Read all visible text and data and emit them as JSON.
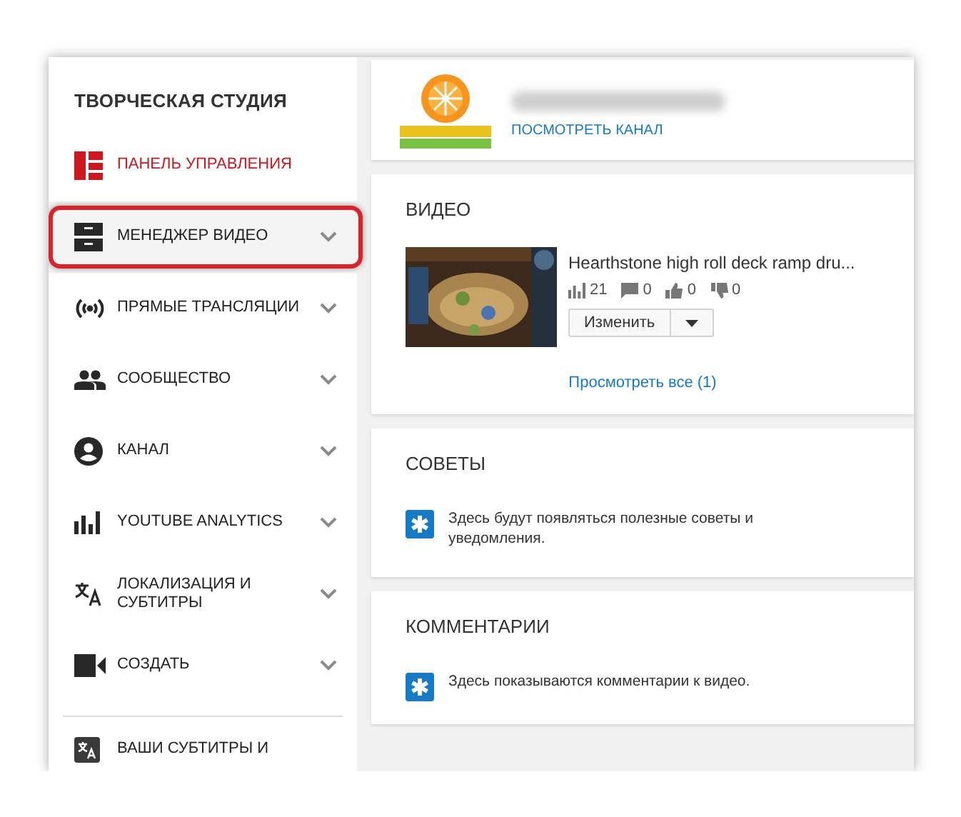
{
  "sidebar": {
    "title": "ТВОРЧЕСКАЯ СТУДИЯ",
    "items": [
      {
        "label": "ПАНЕЛЬ УПРАВЛЕНИЯ",
        "selected": true,
        "expandable": false,
        "highlighted": false
      },
      {
        "label": "МЕНЕДЖЕР ВИДЕО",
        "selected": false,
        "expandable": true,
        "highlighted": true
      },
      {
        "label": "ПРЯМЫЕ ТРАНСЛЯЦИИ",
        "selected": false,
        "expandable": true,
        "highlighted": false
      },
      {
        "label": "СООБЩЕСТВО",
        "selected": false,
        "expandable": true,
        "highlighted": false
      },
      {
        "label": "КАНАЛ",
        "selected": false,
        "expandable": true,
        "highlighted": false
      },
      {
        "label": "YOUTUBE ANALYTICS",
        "selected": false,
        "expandable": true,
        "highlighted": false
      },
      {
        "label": "ЛОКАЛИЗАЦИЯ И СУБТИТРЫ",
        "selected": false,
        "expandable": true,
        "highlighted": false
      },
      {
        "label": "СОЗДАТЬ",
        "selected": false,
        "expandable": true,
        "highlighted": false
      }
    ],
    "footer_items": [
      {
        "label": "ВАШИ СУБТИТРЫ И"
      }
    ]
  },
  "channel": {
    "link": "ПОСМОТРЕТЬ КАНАЛ"
  },
  "video_card": {
    "title": "ВИДЕО",
    "video": {
      "title": "Hearthstone high roll deck ramp dru...",
      "views": "21",
      "comments": "0",
      "likes": "0",
      "dislikes": "0"
    },
    "edit_button": "Изменить",
    "view_all_link": "Просмотреть все (1)"
  },
  "info_cards": [
    {
      "title": "СОВЕТЫ",
      "message": "Здесь будут появляться полезные советы и уведомления."
    },
    {
      "title": "КОММЕНТАРИИ",
      "message": "Здесь показываются комментарии к видео."
    }
  ]
}
